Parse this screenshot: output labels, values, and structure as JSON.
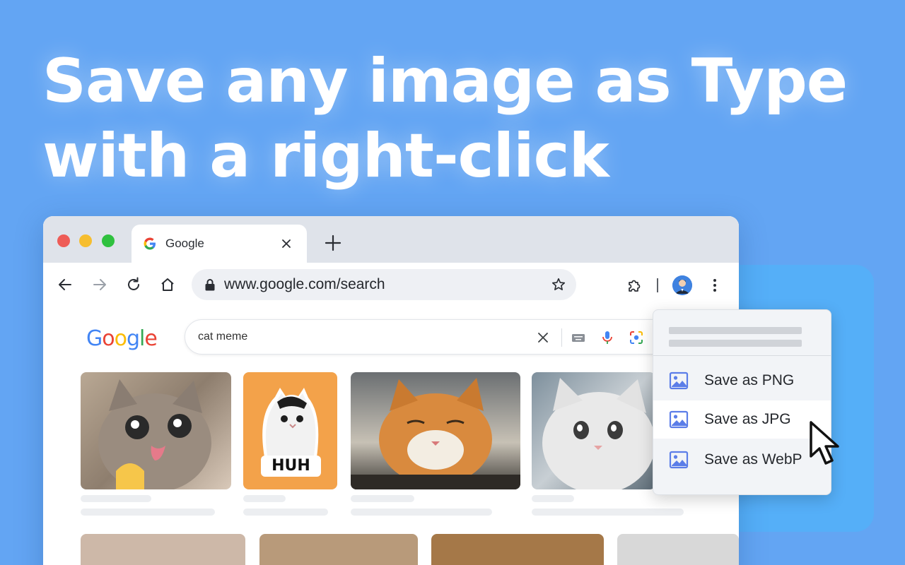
{
  "headline": {
    "line1": "Save any image as Type",
    "line2": "with a right-click"
  },
  "browser": {
    "tab_title": "Google",
    "url": "www.google.com/search",
    "icons": [
      "back-arrow-icon",
      "forward-arrow-icon",
      "reload-icon",
      "home-icon",
      "lock-icon",
      "star-icon",
      "extensions-puzzle-icon",
      "kebab-menu-icon"
    ]
  },
  "google": {
    "logo": [
      "G",
      "o",
      "o",
      "g",
      "l",
      "e"
    ],
    "search_query": "cat meme"
  },
  "results": {
    "thumbs": [
      {
        "label": "cat-thumb-1"
      },
      {
        "label": "cat-thumb-2",
        "sticker_text": "HUH"
      },
      {
        "label": "cat-thumb-3"
      },
      {
        "label": "cat-thumb-4"
      }
    ]
  },
  "context_menu": {
    "items": [
      {
        "label": "Save as PNG"
      },
      {
        "label": "Save as JPG"
      },
      {
        "label": "Save as WebP"
      }
    ],
    "active_index": 1
  },
  "colors": {
    "background": "#63a5f3",
    "menu_icon": "#5b7de8"
  }
}
